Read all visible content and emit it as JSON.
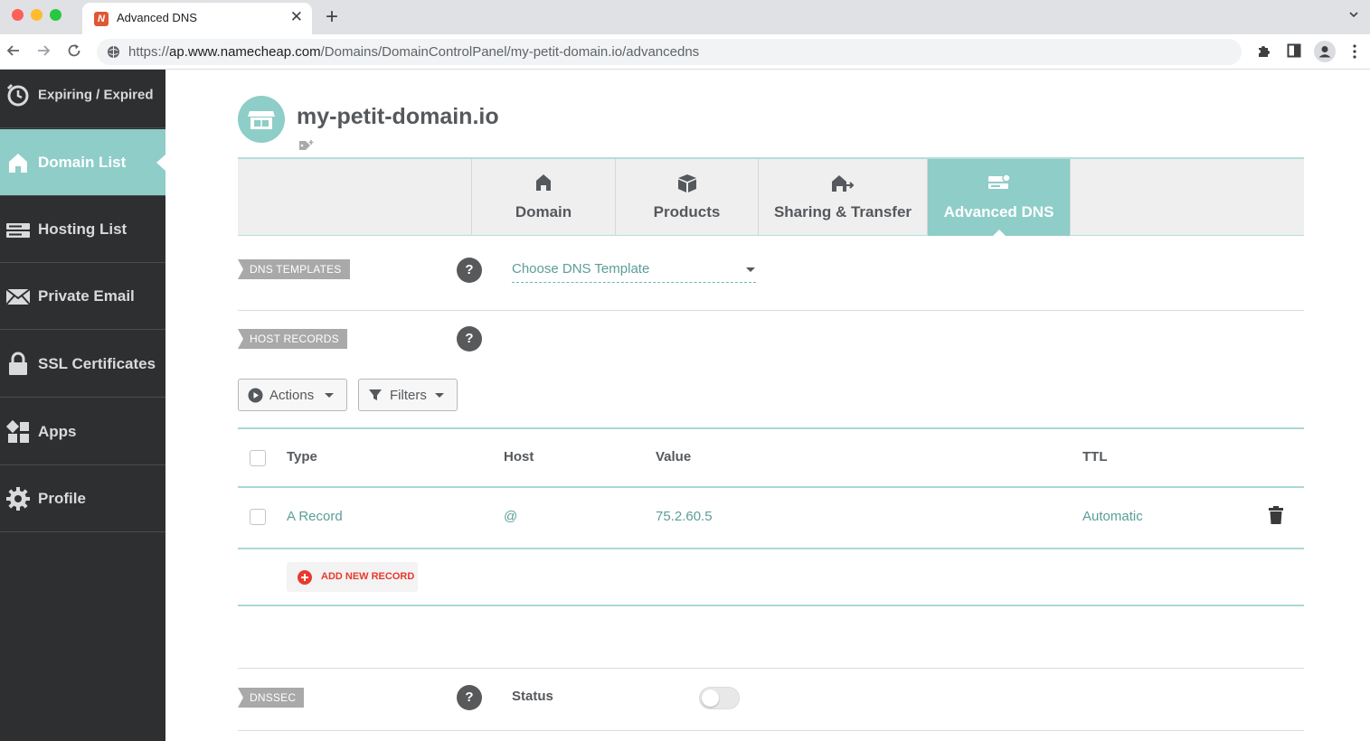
{
  "browser": {
    "tab_title": "Advanced DNS",
    "url_prefix": "https://",
    "url_host": "ap.www.namecheap.com",
    "url_path": "/Domains/DomainControlPanel/my-petit-domain.io/advancedns"
  },
  "sidebar": {
    "items": [
      {
        "label": "Expiring / Expired",
        "icon": "stopwatch-icon",
        "active": false
      },
      {
        "label": "Domain List",
        "icon": "home-icon",
        "active": true
      },
      {
        "label": "Hosting List",
        "icon": "server-icon",
        "active": false
      },
      {
        "label": "Private Email",
        "icon": "envelope-icon",
        "active": false
      },
      {
        "label": "SSL Certificates",
        "icon": "lock-icon",
        "active": false
      },
      {
        "label": "Apps",
        "icon": "apps-icon",
        "active": false
      },
      {
        "label": "Profile",
        "icon": "gear-icon",
        "active": false
      }
    ]
  },
  "domain": {
    "name": "my-petit-domain.io"
  },
  "domain_tabs": [
    {
      "label": "Domain",
      "icon": "home-icon",
      "active": false
    },
    {
      "label": "Products",
      "icon": "box-icon",
      "active": false
    },
    {
      "label": "Sharing & Transfer",
      "icon": "transfer-icon",
      "active": false
    },
    {
      "label": "Advanced DNS",
      "icon": "dns-icon",
      "active": true
    }
  ],
  "dns_templates": {
    "section_label": "DNS TEMPLATES",
    "help": "?",
    "select_placeholder": "Choose DNS Template"
  },
  "host_records": {
    "section_label": "HOST RECORDS",
    "help": "?",
    "actions_label": "Actions",
    "filters_label": "Filters",
    "columns": [
      "Type",
      "Host",
      "Value",
      "TTL"
    ],
    "rows": [
      {
        "type": "A Record",
        "host": "@",
        "value": "75.2.60.5",
        "ttl": "Automatic"
      }
    ],
    "add_label": "ADD NEW RECORD"
  },
  "dnssec": {
    "section_label": "DNSSEC",
    "help": "?",
    "status_label": "Status",
    "enabled": false
  },
  "colors": {
    "accent": "#8ecdc8",
    "sidebar_bg": "#2d2f31",
    "danger": "#e8392e"
  }
}
